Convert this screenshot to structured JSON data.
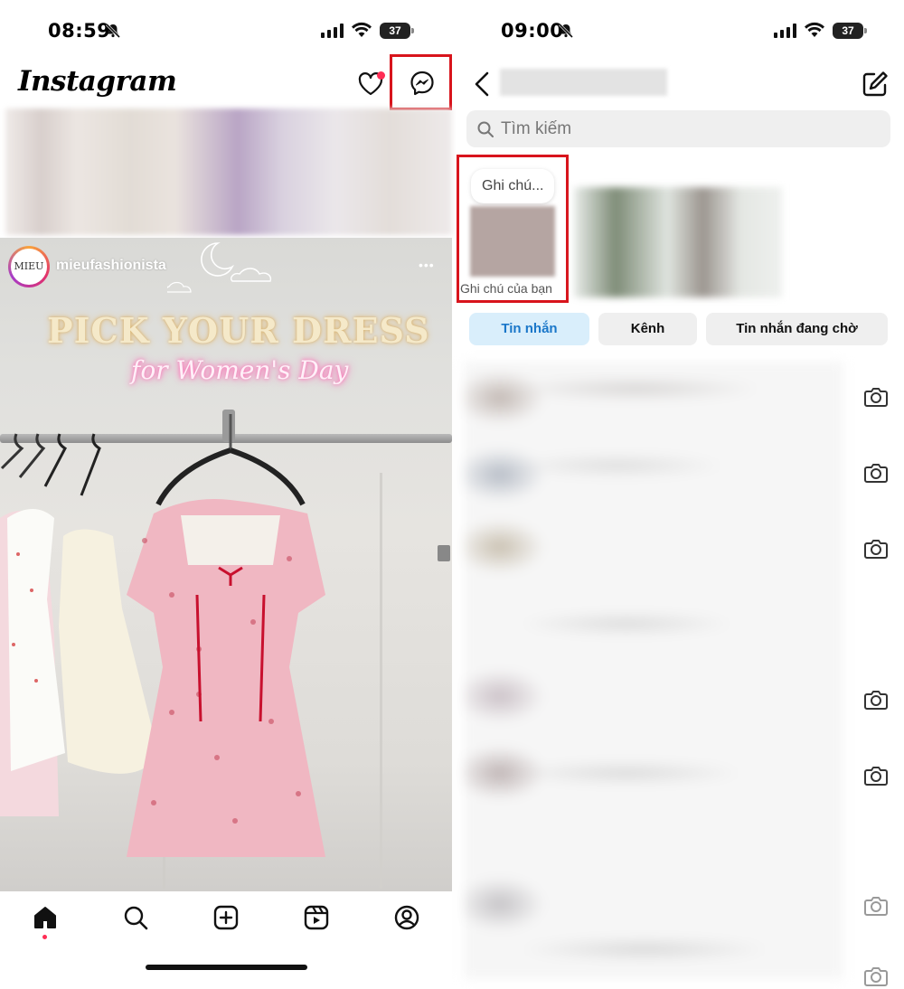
{
  "left": {
    "status_time": "08:59",
    "battery": "37",
    "app_logo": "Instagram",
    "post": {
      "username": "mieufashionista",
      "avatar_text": "MIEU",
      "title_line1": "PICK YOUR DRESS",
      "title_line2": "for Women's Day",
      "more": "•••"
    },
    "nav": [
      "home-icon",
      "search-icon",
      "create-icon",
      "reels-icon",
      "profile-icon"
    ]
  },
  "right": {
    "status_time": "09:00",
    "battery": "37",
    "search_placeholder": "Tìm kiếm",
    "note_bubble": "Ghi chú...",
    "note_label": "Ghi chú của bạn",
    "tabs": [
      "Tin nhắn",
      "Kênh",
      "Tin nhắn đang chờ"
    ],
    "thread_camera_icons": "camera-icon"
  },
  "colors": {
    "highlight_box": "#d8141c",
    "active_tab_bg": "#d9eefb",
    "active_tab_text": "#1a77c9",
    "notification_dot": "#ff2d55"
  }
}
